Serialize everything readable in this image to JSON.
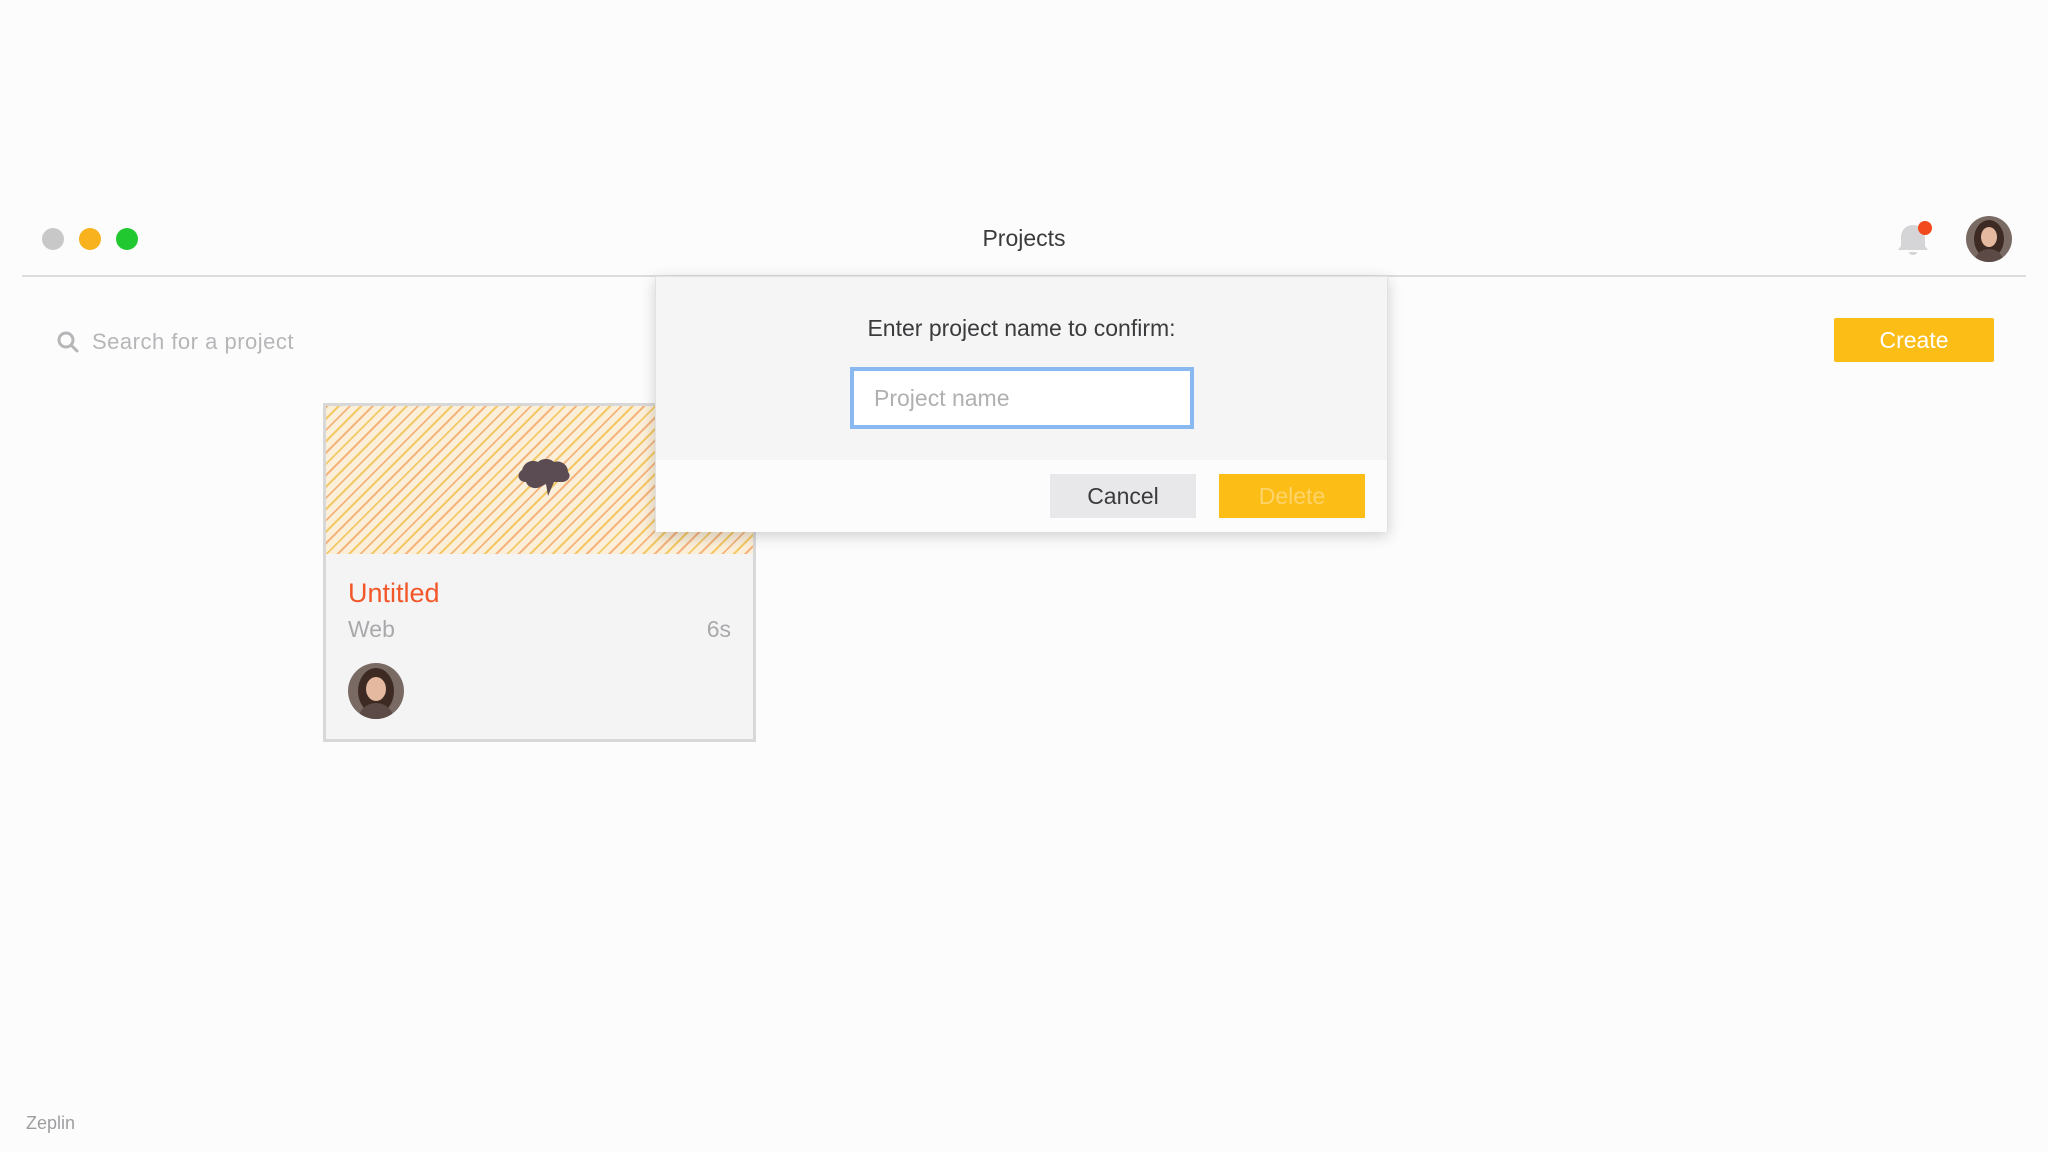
{
  "window": {
    "title": "Projects"
  },
  "toolbar": {
    "search_placeholder": "Search for a project",
    "search_icon": "search-icon",
    "create_label": "Create"
  },
  "notifications": {
    "icon": "bell-icon",
    "has_unread": true
  },
  "project_card": {
    "title": "Untitled",
    "type": "Web",
    "updated": "6s"
  },
  "dialog": {
    "title": "Enter project name to confirm:",
    "input_placeholder": "Project name",
    "input_value": "",
    "cancel_label": "Cancel",
    "delete_label": "Delete"
  },
  "footer": {
    "brand": "Zeplin"
  },
  "colors": {
    "accent": "#fdbd17",
    "title_orange": "#f2572a",
    "focus_blue": "#8ab8f0",
    "notification_dot": "#f24a1d"
  }
}
